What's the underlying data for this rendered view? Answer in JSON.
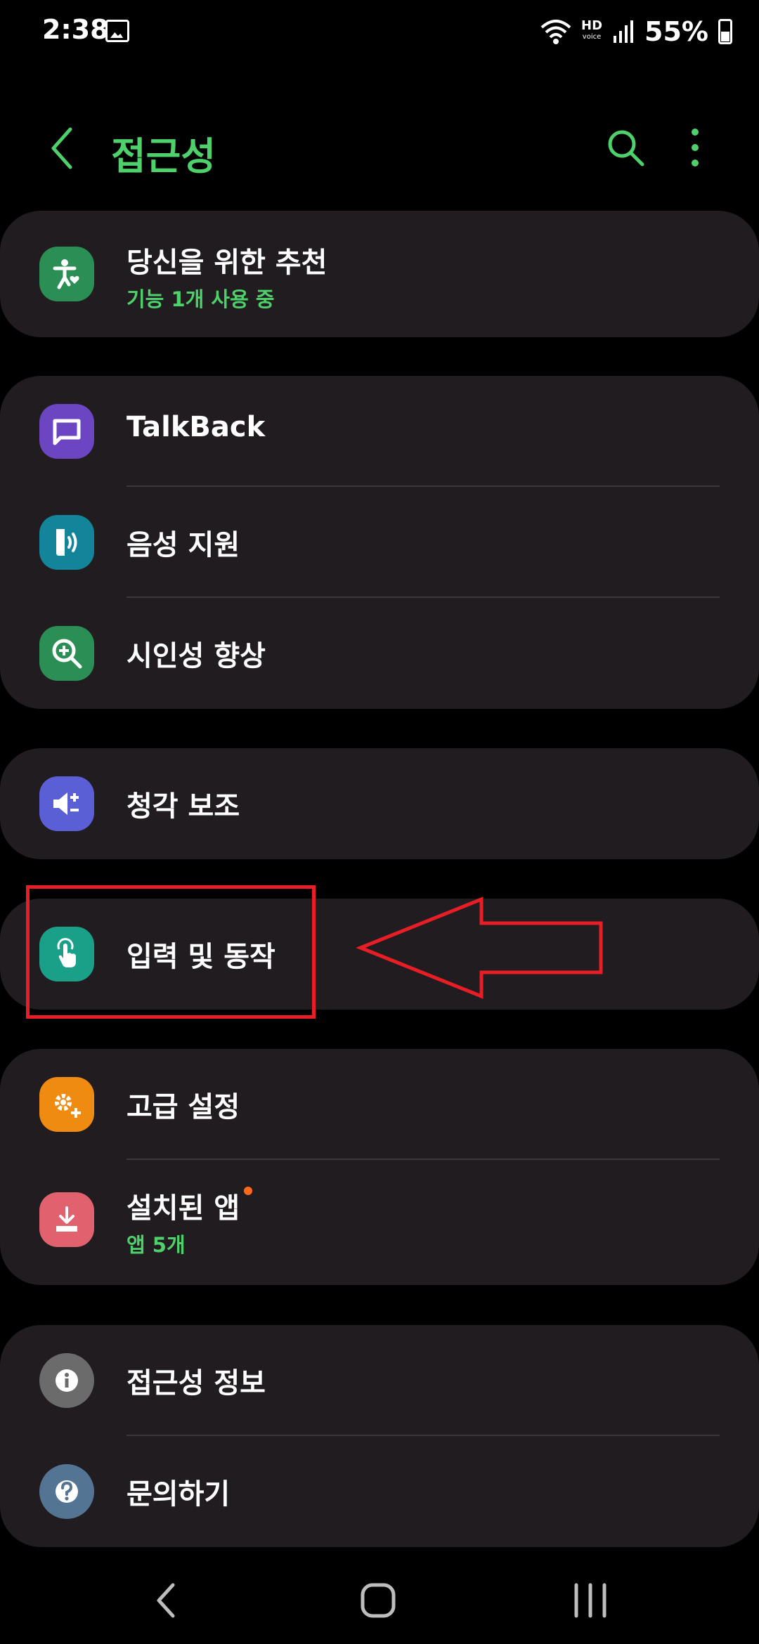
{
  "status_bar": {
    "time": "2:38",
    "battery_percent": "55%",
    "hd_label": "HD",
    "hd_sub": "voice"
  },
  "header": {
    "title": "접근성"
  },
  "cards": {
    "recommended": {
      "title": "당신을 위한 추천",
      "subtitle": "기능 1개 사용 중"
    },
    "vision": {
      "items": [
        {
          "label": "TalkBack"
        },
        {
          "label": "음성 지원"
        },
        {
          "label": "시인성 향상"
        }
      ]
    },
    "hearing": {
      "label": "청각 보조"
    },
    "input": {
      "label": "입력 및 동작"
    },
    "advanced": {
      "items": [
        {
          "label": "고급 설정"
        },
        {
          "label": "설치된 앱",
          "subtitle": "앱 5개"
        }
      ]
    },
    "about": {
      "items": [
        {
          "label": "접근성 정보"
        },
        {
          "label": "문의하기"
        }
      ]
    }
  },
  "colors": {
    "accent_green": "#4ed06a",
    "card_bg": "#201c20",
    "annotation_red": "#e81e26",
    "new_badge": "#ff6a1a"
  },
  "icons": {
    "recommended": "accessibility-person-heart-icon",
    "talkback": "speech-bubble-icon",
    "voice_assistant": "sound-waves-icon",
    "visibility": "magnifier-plus-icon",
    "hearing": "speaker-plus-minus-icon",
    "input": "touch-hand-icon",
    "advanced": "gears-plus-icon",
    "installed_apps": "download-tray-icon",
    "about": "info-icon",
    "contact": "question-icon"
  }
}
